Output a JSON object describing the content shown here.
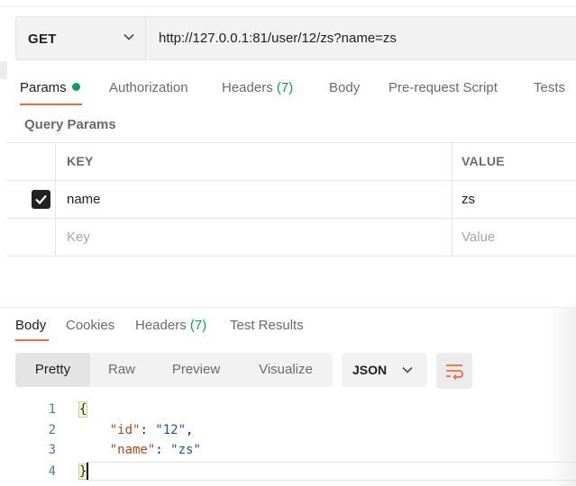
{
  "request": {
    "method": "GET",
    "url": "http://127.0.0.1:81/user/12/zs?name=zs"
  },
  "request_tabs": [
    {
      "label": "Params",
      "active": true
    },
    {
      "label": "Authorization"
    },
    {
      "label": "Headers",
      "count": "(7)"
    },
    {
      "label": "Body"
    },
    {
      "label": "Pre-request Script"
    },
    {
      "label": "Tests"
    }
  ],
  "query_params": {
    "title": "Query Params",
    "columns": {
      "key": "KEY",
      "value": "VALUE"
    },
    "rows": [
      {
        "key": "name",
        "value": "zs",
        "checked": true
      }
    ],
    "placeholder": {
      "key": "Key",
      "value": "Value"
    }
  },
  "response_tabs": [
    {
      "label": "Body",
      "active": true
    },
    {
      "label": "Cookies"
    },
    {
      "label": "Headers",
      "count": "(7)"
    },
    {
      "label": "Test Results"
    }
  ],
  "view_modes": [
    "Pretty",
    "Raw",
    "Preview",
    "Visualize"
  ],
  "active_view": "Pretty",
  "format": "JSON",
  "code": {
    "line_numbers": [
      "1",
      "2",
      "3",
      "4"
    ],
    "open_brace": "{",
    "close_brace": "}",
    "entries": [
      {
        "key": "\"id\"",
        "value": "\"12\"",
        "comma": ","
      },
      {
        "key": "\"name\"",
        "value": "\"zs\"",
        "comma": ""
      }
    ]
  },
  "colors": {
    "accent_orange": "#f26b3a",
    "status_green": "#0f9d58",
    "json_key": "#a8481e",
    "json_string": "#1d4fa6",
    "line_number": "#4a7aa7"
  },
  "icons": {
    "method_dropdown": "chevron-down-icon",
    "format_dropdown": "chevron-down-icon",
    "wrap": "wrap-lines-icon",
    "checkbox": "check-icon"
  }
}
